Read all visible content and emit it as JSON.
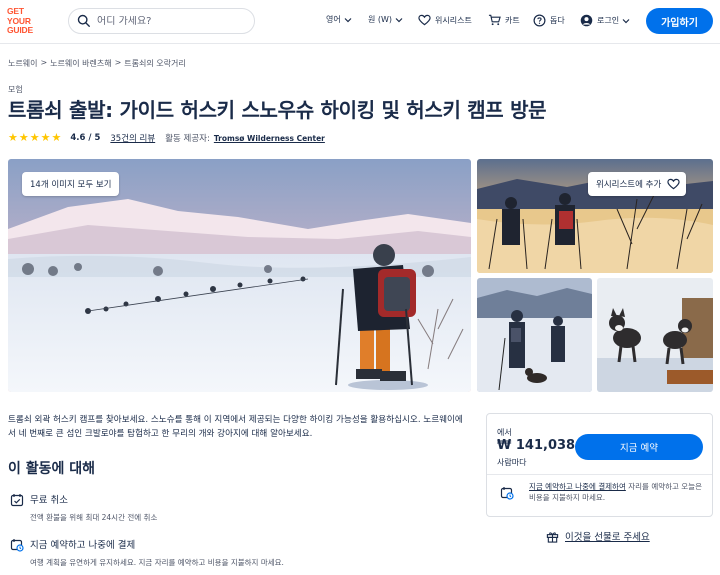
{
  "header": {
    "logo_lines": [
      "GET",
      "YOUR",
      "GUIDE"
    ],
    "search_placeholder": "어디 가세요?",
    "language": "영어",
    "currency": "원 (W)",
    "wishlist": "위시리스트",
    "cart": "카트",
    "help": "돕다",
    "login": "로그인",
    "signup": "가입하기"
  },
  "breadcrumb": [
    "노르웨이",
    "노르웨이 바렌츠해",
    "트롬쇠의 오락거리"
  ],
  "category": "모험",
  "title": "트롬쇠 출발: 가이드 허스키 스노우슈 하이킹 및 허스키 캠프 방문",
  "rating": {
    "stars": 5,
    "value": "4.6 / 5",
    "reviews": "35건의 리뷰",
    "provider_label": "활동 제공자:",
    "provider": "Tromsø Wilderness Center"
  },
  "gallery": {
    "all_photos": "14개 이미지 모두 보기",
    "add_wishlist": "위시리스트에 추가"
  },
  "description": "트롬쇠 외곽 허스키 캠프를 찾아보세요. 스노슈를 통해 이 지역에서 제공되는 다양한 하이킹 가능성을 활용하십시오. 노르웨이에서 네 번째로 큰 섬인 크발로야를 탐험하고 한 무리의 개와 강아지에 대해 알아보세요.",
  "about": {
    "title": "이 활동에 대해",
    "features": [
      {
        "title": "무료 취소",
        "subtitle": "전액 환불을 위해 최대 24시간 전에 취소"
      },
      {
        "title": "지금 예약하고 나중에 결제",
        "subtitle": "여행 계획을 유연하게 유지하세요. 지금 자리를 예약하고 비용을 지불하지 마세요."
      }
    ]
  },
  "booking": {
    "from": "에서",
    "price": "₩ 141,038",
    "per": "사람마다",
    "button": "지금 예약",
    "rnpl_link": "지금 예약하고 나중에 결제하여",
    "rnpl_text": " 자리를 예약하고 오늘은 비용을 지불하지 마세요.",
    "gift": "이것을 선물로 주세요"
  },
  "colors": {
    "brand": "#ff5533",
    "primary": "#0071eb",
    "star": "#ffc600",
    "text": "#1a2b49"
  }
}
